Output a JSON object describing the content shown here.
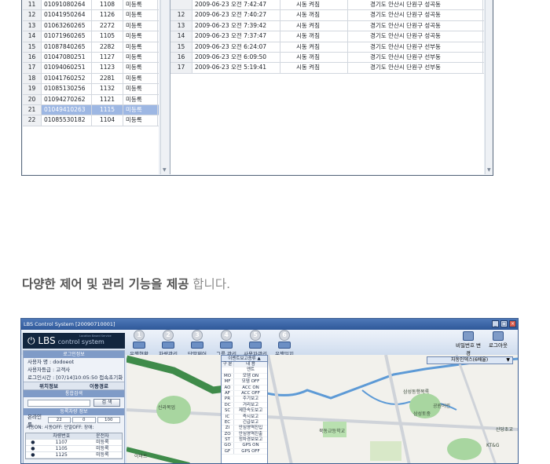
{
  "top_left_table": [
    {
      "n": "11",
      "phone": "01091080264",
      "id": "1108",
      "status": "미등록"
    },
    {
      "n": "12",
      "phone": "01041950264",
      "id": "1126",
      "status": "미등록"
    },
    {
      "n": "13",
      "phone": "01063260265",
      "id": "2272",
      "status": "미등록"
    },
    {
      "n": "14",
      "phone": "01071960265",
      "id": "1105",
      "status": "미등록"
    },
    {
      "n": "15",
      "phone": "01087840265",
      "id": "2282",
      "status": "미등록"
    },
    {
      "n": "16",
      "phone": "01047080251",
      "id": "1127",
      "status": "미등록"
    },
    {
      "n": "17",
      "phone": "01094060251",
      "id": "1123",
      "status": "미등록"
    },
    {
      "n": "18",
      "phone": "01041760252",
      "id": "2281",
      "status": "미등록"
    },
    {
      "n": "19",
      "phone": "01085130256",
      "id": "1132",
      "status": "미등록"
    },
    {
      "n": "20",
      "phone": "01094270262",
      "id": "1121",
      "status": "미등록"
    },
    {
      "n": "21",
      "phone": "01049410263",
      "id": "1115",
      "status": "미등록"
    },
    {
      "n": "22",
      "phone": "01085530182",
      "id": "1104",
      "status": "미등록"
    }
  ],
  "top_right_table": [
    {
      "n": "",
      "time": "2009-06-23 오전 7:42:47",
      "event": "시동 켜짐",
      "addr": "경기도 안산시 단원구 성곡동"
    },
    {
      "n": "12",
      "time": "2009-06-23 오전 7:40:27",
      "event": "시동 꺼짐",
      "addr": "경기도 안산시 단원구 성곡동"
    },
    {
      "n": "13",
      "time": "2009-06-23 오전 7:39:42",
      "event": "시동 켜짐",
      "addr": "경기도 안산시 단원구 성곡동"
    },
    {
      "n": "14",
      "time": "2009-06-23 오전 7:37:47",
      "event": "시동 꺼짐",
      "addr": "경기도 안산시 단원구 성곡동"
    },
    {
      "n": "15",
      "time": "2009-06-23 오전 6:24:07",
      "event": "시동 켜짐",
      "addr": "경기도 안산시 단원구 선부동"
    },
    {
      "n": "16",
      "time": "2009-06-23 오전 6:09:50",
      "event": "시동 꺼짐",
      "addr": "경기도 안산시 단원구 선부동"
    },
    {
      "n": "17",
      "time": "2009-06-23 오전 5:19:41",
      "event": "시동 켜짐",
      "addr": "경기도 안산시 단원구 선부동"
    }
  ],
  "caption": {
    "bold": "다양한 제어 및 관리 기능을 제공",
    "light": " 합니다."
  },
  "app": {
    "title": "LBS Control System [20090710001]",
    "logo_main": "LBS",
    "logo_sub": "control system",
    "logo_tiny": "Location Based Service",
    "toolbar": [
      {
        "num": "1",
        "label": "운행현황"
      },
      {
        "num": "2",
        "label": "차량관리"
      },
      {
        "num": "3",
        "label": "단말제어"
      },
      {
        "num": "4",
        "label": "그룹 관리"
      },
      {
        "num": "5",
        "label": "사용자관리"
      },
      {
        "num": "6",
        "label": "운행일지"
      }
    ],
    "right_tools": [
      {
        "label": "비밀번호 변경"
      },
      {
        "label": "로그아웃"
      }
    ],
    "login_head": "로그인정보",
    "login_lines": [
      "사용자 명 : dodoeot",
      "사용자등급 : 고객사",
      "로그인시간 : [07/14]10:05:50  접속초기화"
    ],
    "tabs": [
      "위치정보",
      "이동경로"
    ],
    "search_head": "통합검색",
    "search_button": "검 색",
    "reg_head": "등록차량 정보",
    "online_label": "온라인률",
    "online_values": [
      "22",
      "0",
      "100"
    ],
    "legend": "시동ON:  시동OFF:  단말OFF:  장애:",
    "vehicle_header": [
      "차량번호",
      "운전자"
    ],
    "vehicles": [
      {
        "no": "1107",
        "driver": "미등록"
      },
      {
        "no": "1105",
        "driver": "미등록"
      },
      {
        "no": "1125",
        "driver": "미등록"
      }
    ],
    "event_title": "이벤트보고종류 ▲",
    "event_header": [
      "구 분",
      "내 용"
    ],
    "events": [
      {
        "code": "",
        "desc": "엔트"
      },
      {
        "code": "MO",
        "desc": "모뎀 ON"
      },
      {
        "code": "MF",
        "desc": "모뎀 OFF"
      },
      {
        "code": "AO",
        "desc": "ACC ON"
      },
      {
        "code": "AF",
        "desc": "ACC OFF"
      },
      {
        "code": "PR",
        "desc": "주기보고"
      },
      {
        "code": "DC",
        "desc": "거리보고"
      },
      {
        "code": "SC",
        "desc": "제한속도보고"
      },
      {
        "code": "IC",
        "desc": "즉시보고"
      },
      {
        "code": "EC",
        "desc": "긴급보고"
      },
      {
        "code": "ZI",
        "desc": "안심영역진입"
      },
      {
        "code": "ZO",
        "desc": "안심영역진출"
      },
      {
        "code": "ST",
        "desc": "정차경보보고"
      },
      {
        "code": "GO",
        "desc": "GPS ON"
      },
      {
        "code": "GF",
        "desc": "GPS OFF"
      }
    ],
    "map_bar": "자동인덱스(6배율)",
    "map_labels": [
      "신라목업",
      "삼성동행목록",
      "삼성토중",
      "북동교등학교",
      "공원어린",
      "이마트",
      "KT&G",
      "산당초교"
    ]
  }
}
